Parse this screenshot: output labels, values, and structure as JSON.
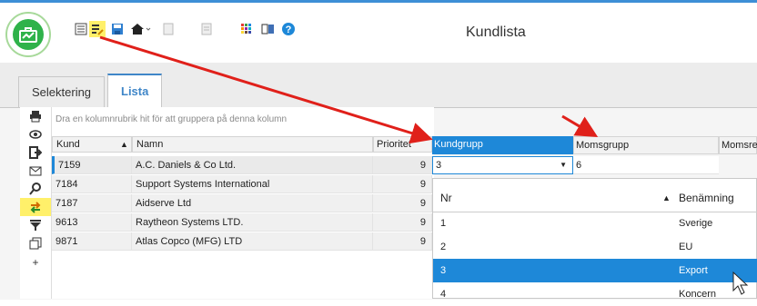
{
  "window": {
    "title": "Kundlista"
  },
  "toolbar": {
    "icons": [
      "list-icon",
      "edit-list-icon",
      "save-icon",
      "home-icon",
      "doc-icon",
      "doc2-icon",
      "grid-colors-icon",
      "cards-icon",
      "help-icon"
    ]
  },
  "tabs": [
    {
      "label": "Selektering"
    },
    {
      "label": "Lista"
    }
  ],
  "grid": {
    "group_hint": "Dra en kolumnrubrik hit för att gruppera på denna kolumn",
    "columns": {
      "kund": "Kund",
      "namn": "Namn",
      "prioritet": "Prioritet",
      "kundgrupp": "Kundgrupp",
      "momsgrupp": "Momsgrupp",
      "momsreg": "Momsre"
    },
    "rows": [
      {
        "kund": "7159",
        "namn": "A.C. Daniels & Co Ltd.",
        "prioritet": "9"
      },
      {
        "kund": "7184",
        "namn": "Support Systems International",
        "prioritet": "9"
      },
      {
        "kund": "7187",
        "namn": "Aidserve Ltd",
        "prioritet": "9"
      },
      {
        "kund": "9613",
        "namn": "Raytheon Systems LTD.",
        "prioritet": "9"
      },
      {
        "kund": "9871",
        "namn": "Atlas Copco (MFG) LTD",
        "prioritet": "9"
      }
    ],
    "edit": {
      "kundgrupp_value": "3",
      "momsgrupp_value": "6"
    }
  },
  "dropdown": {
    "col_nr": "Nr",
    "col_name": "Benämning",
    "items": [
      {
        "nr": "1",
        "name": "Sverige"
      },
      {
        "nr": "2",
        "name": "EU"
      },
      {
        "nr": "3",
        "name": "Export"
      },
      {
        "nr": "4",
        "name": "Koncern"
      }
    ],
    "selected_index": 2
  },
  "colors": {
    "accent": "#1e88d8",
    "arrow": "#e0201a",
    "highlight": "#fff06a",
    "logo": "#2fb24a"
  }
}
